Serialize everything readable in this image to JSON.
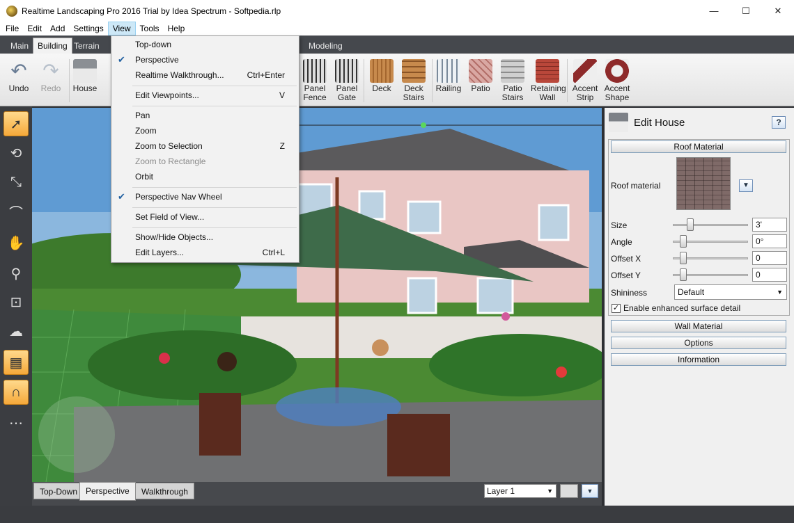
{
  "window": {
    "title": "Realtime Landscaping Pro 2016 Trial by Idea Spectrum - Softpedia.rlp",
    "controls": {
      "minimize": "—",
      "maximize": "☐",
      "close": "✕"
    }
  },
  "menubar": [
    "File",
    "Edit",
    "Add",
    "Settings",
    "View",
    "Tools",
    "Help"
  ],
  "tabs": [
    "Main",
    "Building",
    "Terrain",
    "Modeling"
  ],
  "ribbon": {
    "undo": "Undo",
    "redo": "Redo",
    "house": "House",
    "panel_fence": [
      "Panel",
      "Fence"
    ],
    "panel_gate": [
      "Panel",
      "Gate"
    ],
    "deck": "Deck",
    "deck_stairs": [
      "Deck",
      "Stairs"
    ],
    "railing": "Railing",
    "patio": "Patio",
    "patio_stairs": [
      "Patio",
      "Stairs"
    ],
    "retaining_wall": [
      "Retaining",
      "Wall"
    ],
    "accent_strip": [
      "Accent",
      "Strip"
    ],
    "accent_shape": [
      "Accent",
      "Shape"
    ]
  },
  "view_menu": {
    "items": [
      {
        "label": "Top-down",
        "shortcut": "",
        "checked": false,
        "disabled": false
      },
      {
        "label": "Perspective",
        "shortcut": "",
        "checked": true,
        "disabled": false
      },
      {
        "label": "Realtime Walkthrough...",
        "shortcut": "Ctrl+Enter",
        "checked": false,
        "disabled": false
      },
      {
        "label": "Edit Viewpoints...",
        "shortcut": "V",
        "checked": false,
        "disabled": false
      },
      {
        "label": "Pan",
        "shortcut": "",
        "checked": false,
        "disabled": false
      },
      {
        "label": "Zoom",
        "shortcut": "",
        "checked": false,
        "disabled": false
      },
      {
        "label": "Zoom to Selection",
        "shortcut": "Z",
        "checked": false,
        "disabled": false
      },
      {
        "label": "Zoom to Rectangle",
        "shortcut": "",
        "checked": false,
        "disabled": true
      },
      {
        "label": "Orbit",
        "shortcut": "",
        "checked": false,
        "disabled": false
      },
      {
        "label": "Perspective Nav Wheel",
        "shortcut": "",
        "checked": true,
        "disabled": false
      },
      {
        "label": "Set Field of View...",
        "shortcut": "",
        "checked": false,
        "disabled": false
      },
      {
        "label": "Show/Hide Objects...",
        "shortcut": "",
        "checked": false,
        "disabled": false
      },
      {
        "label": "Edit Layers...",
        "shortcut": "Ctrl+L",
        "checked": false,
        "disabled": false
      }
    ]
  },
  "viewport_tabs": [
    "Top-Down",
    "Perspective",
    "Walkthrough"
  ],
  "layer": {
    "selected": "Layer 1"
  },
  "panel": {
    "title": "Edit House",
    "help": "?",
    "roof_material_btn": "Roof Material",
    "roof_material_label": "Roof material",
    "size_label": "Size",
    "size_value": "3'",
    "size_level": 0.2,
    "angle_label": "Angle",
    "angle_value": "0°",
    "angle_level": 0.1,
    "offset_x_label": "Offset X",
    "offset_x_value": "0",
    "offset_x_level": 0.1,
    "offset_y_label": "Offset Y",
    "offset_y_value": "0",
    "offset_y_level": 0.1,
    "shininess_label": "Shininess",
    "shininess_value": "Default",
    "enhanced_label": "Enable enhanced surface detail",
    "enhanced_checked": true,
    "wall_material": "Wall Material",
    "options": "Options",
    "information": "Information"
  }
}
